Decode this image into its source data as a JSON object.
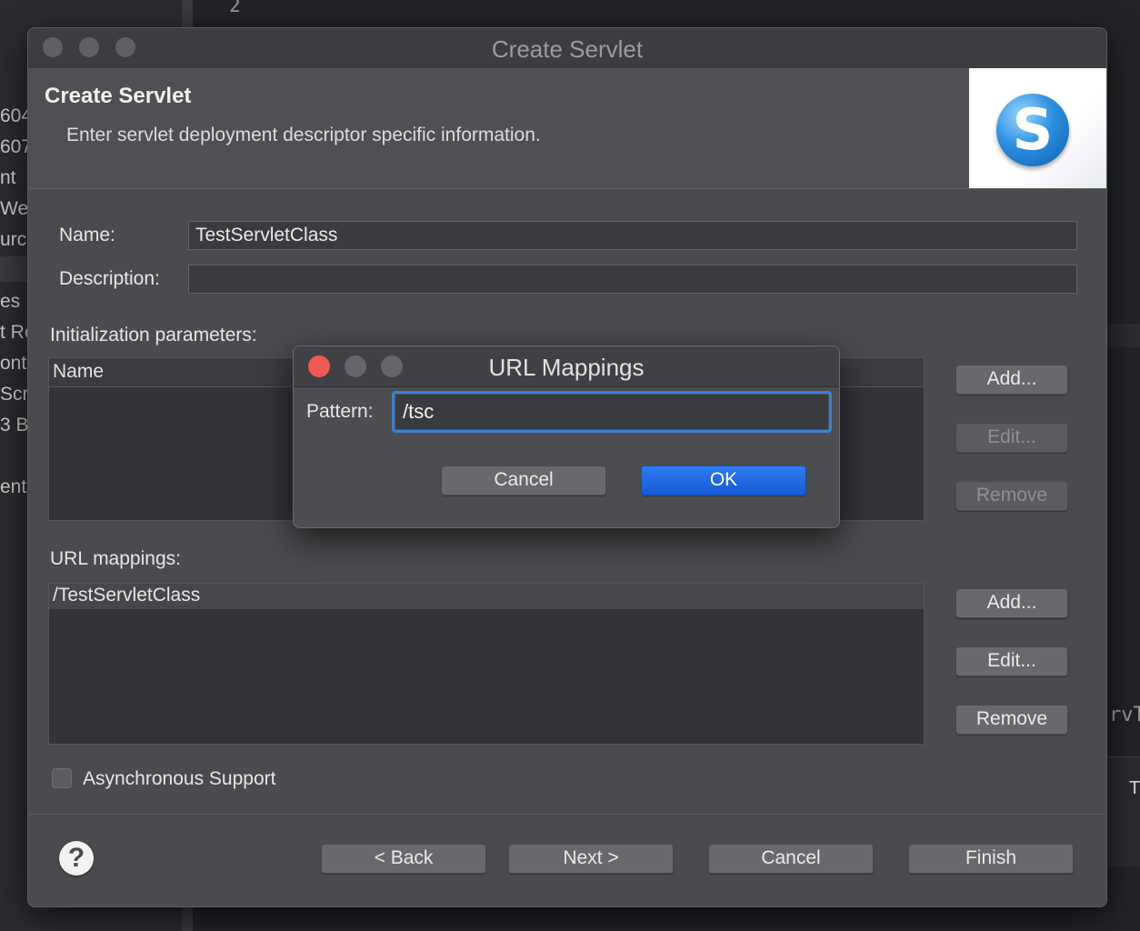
{
  "background": {
    "line_number": "2",
    "left_fragments": [
      "604",
      "607",
      "nt",
      "Web",
      "urc",
      "es",
      "t Re",
      "onte",
      "Scri",
      "3 B",
      "ent"
    ],
    "right_fragment": "rvT",
    "t_fragment": "T"
  },
  "dialog": {
    "window_title": "Create Servlet",
    "header_title": "Create Servlet",
    "header_description": "Enter servlet deployment descriptor specific information.",
    "logo_letter": "S",
    "name_label": "Name:",
    "name_value": "TestServletClass",
    "description_label": "Description:",
    "description_value": "",
    "init_params_label": "Initialization parameters:",
    "init_params_columns": [
      "Name"
    ],
    "init_buttons": {
      "add": "Add...",
      "edit": "Edit...",
      "remove": "Remove"
    },
    "url_mappings_label": "URL mappings:",
    "url_mappings": [
      "/TestServletClass"
    ],
    "url_buttons": {
      "add": "Add...",
      "edit": "Edit...",
      "remove": "Remove"
    },
    "async_label": "Asynchronous Support",
    "async_checked": false,
    "help_symbol": "?",
    "footer": {
      "back": "< Back",
      "next": "Next >",
      "cancel": "Cancel",
      "finish": "Finish"
    }
  },
  "url_dialog": {
    "title": "URL Mappings",
    "pattern_label": "Pattern:",
    "pattern_value": "/tsc",
    "cancel": "Cancel",
    "ok": "OK"
  },
  "colors": {
    "primary_button": "#1f66e0",
    "close_button": "#ee5a52"
  }
}
